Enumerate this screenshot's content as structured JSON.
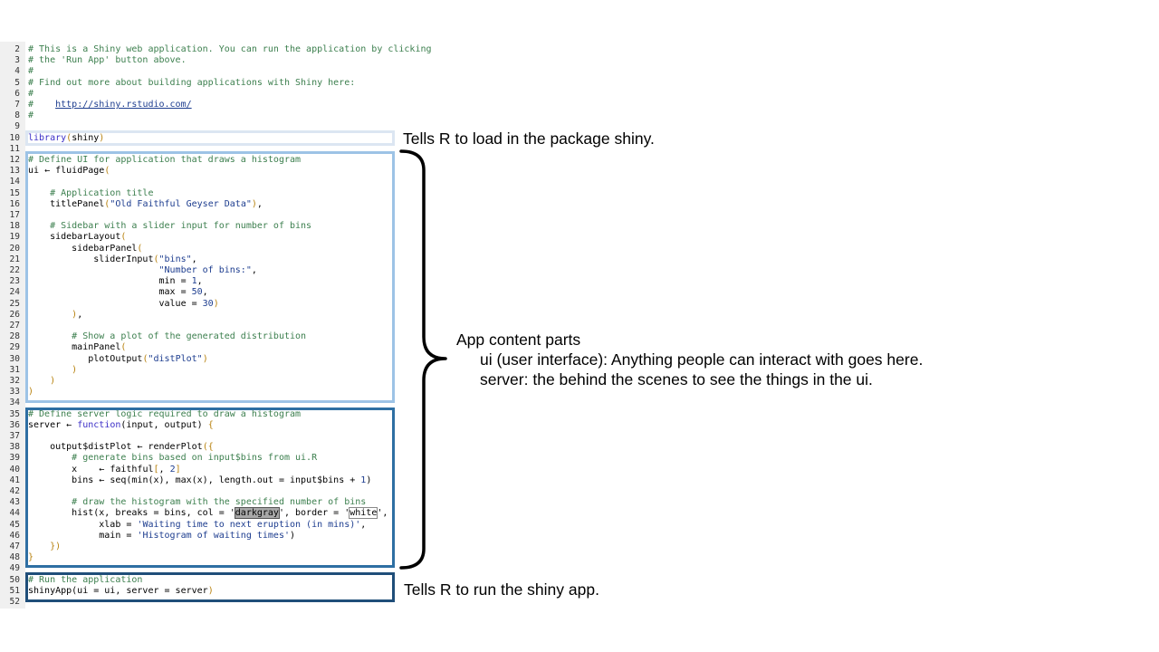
{
  "code_lines": [
    {
      "num": "2",
      "tokens": [
        {
          "t": "# This is a Shiny web application. You can run the application by clicking",
          "c": "comment"
        }
      ]
    },
    {
      "num": "3",
      "tokens": [
        {
          "t": "# the 'Run App' button above.",
          "c": "comment"
        }
      ]
    },
    {
      "num": "4",
      "tokens": [
        {
          "t": "#",
          "c": "comment"
        }
      ]
    },
    {
      "num": "5",
      "tokens": [
        {
          "t": "# Find out more about building applications with Shiny here:",
          "c": "comment"
        }
      ]
    },
    {
      "num": "6",
      "tokens": [
        {
          "t": "#",
          "c": "comment"
        }
      ]
    },
    {
      "num": "7",
      "tokens": [
        {
          "t": "#    ",
          "c": "comment"
        },
        {
          "t": "http://shiny.rstudio.com/",
          "c": "link"
        }
      ]
    },
    {
      "num": "8",
      "tokens": [
        {
          "t": "#",
          "c": "comment"
        }
      ]
    },
    {
      "num": "9",
      "tokens": []
    },
    {
      "num": "10",
      "tokens": [
        {
          "t": "library",
          "c": "keyword"
        },
        {
          "t": "(",
          "c": "paren"
        },
        {
          "t": "shiny",
          "c": "ident"
        },
        {
          "t": ")",
          "c": "paren"
        }
      ]
    },
    {
      "num": "11",
      "tokens": []
    },
    {
      "num": "12",
      "tokens": [
        {
          "t": "# Define UI for application that draws a histogram",
          "c": "comment"
        }
      ]
    },
    {
      "num": "13",
      "tokens": [
        {
          "t": "ui ",
          "c": "ident"
        },
        {
          "t": "←",
          "c": "ident"
        },
        {
          "t": " fluidPage",
          "c": "ident"
        },
        {
          "t": "(",
          "c": "paren"
        }
      ]
    },
    {
      "num": "14",
      "tokens": []
    },
    {
      "num": "15",
      "tokens": [
        {
          "t": "    # Application title",
          "c": "comment"
        }
      ]
    },
    {
      "num": "16",
      "tokens": [
        {
          "t": "    titlePanel",
          "c": "ident"
        },
        {
          "t": "(",
          "c": "paren"
        },
        {
          "t": "\"Old Faithful Geyser Data\"",
          "c": "string"
        },
        {
          "t": ")",
          "c": "paren"
        },
        {
          "t": ",",
          "c": "ident"
        }
      ]
    },
    {
      "num": "17",
      "tokens": []
    },
    {
      "num": "18",
      "tokens": [
        {
          "t": "    # Sidebar with a slider input for number of bins",
          "c": "comment"
        }
      ]
    },
    {
      "num": "19",
      "tokens": [
        {
          "t": "    sidebarLayout",
          "c": "ident"
        },
        {
          "t": "(",
          "c": "paren"
        }
      ]
    },
    {
      "num": "20",
      "tokens": [
        {
          "t": "        sidebarPanel",
          "c": "ident"
        },
        {
          "t": "(",
          "c": "paren"
        }
      ]
    },
    {
      "num": "21",
      "tokens": [
        {
          "t": "            sliderInput",
          "c": "ident"
        },
        {
          "t": "(",
          "c": "paren"
        },
        {
          "t": "\"bins\"",
          "c": "string"
        },
        {
          "t": ",",
          "c": "ident"
        }
      ]
    },
    {
      "num": "22",
      "tokens": [
        {
          "t": "                        \"Number of bins:\"",
          "c": "string"
        },
        {
          "t": ",",
          "c": "ident"
        }
      ]
    },
    {
      "num": "23",
      "tokens": [
        {
          "t": "                        min = ",
          "c": "ident"
        },
        {
          "t": "1",
          "c": "number"
        },
        {
          "t": ",",
          "c": "ident"
        }
      ]
    },
    {
      "num": "24",
      "tokens": [
        {
          "t": "                        max = ",
          "c": "ident"
        },
        {
          "t": "50",
          "c": "number"
        },
        {
          "t": ",",
          "c": "ident"
        }
      ]
    },
    {
      "num": "25",
      "tokens": [
        {
          "t": "                        value = ",
          "c": "ident"
        },
        {
          "t": "30",
          "c": "number"
        },
        {
          "t": ")",
          "c": "paren"
        }
      ]
    },
    {
      "num": "26",
      "tokens": [
        {
          "t": "        ",
          "c": "ident"
        },
        {
          "t": ")",
          "c": "paren"
        },
        {
          "t": ",",
          "c": "ident"
        }
      ]
    },
    {
      "num": "27",
      "tokens": []
    },
    {
      "num": "28",
      "tokens": [
        {
          "t": "        # Show a plot of the generated distribution",
          "c": "comment"
        }
      ]
    },
    {
      "num": "29",
      "tokens": [
        {
          "t": "        mainPanel",
          "c": "ident"
        },
        {
          "t": "(",
          "c": "paren"
        }
      ]
    },
    {
      "num": "30",
      "tokens": [
        {
          "t": "           plotOutput",
          "c": "ident"
        },
        {
          "t": "(",
          "c": "paren"
        },
        {
          "t": "\"distPlot\"",
          "c": "string"
        },
        {
          "t": ")",
          "c": "paren"
        }
      ]
    },
    {
      "num": "31",
      "tokens": [
        {
          "t": "        ",
          "c": "ident"
        },
        {
          "t": ")",
          "c": "paren"
        }
      ]
    },
    {
      "num": "32",
      "tokens": [
        {
          "t": "    ",
          "c": "ident"
        },
        {
          "t": ")",
          "c": "paren"
        }
      ]
    },
    {
      "num": "33",
      "tokens": [
        {
          "t": ")",
          "c": "paren"
        }
      ]
    },
    {
      "num": "34",
      "tokens": []
    },
    {
      "num": "35",
      "tokens": [
        {
          "t": "# Define server logic required to draw a histogram",
          "c": "comment"
        }
      ]
    },
    {
      "num": "36",
      "tokens": [
        {
          "t": "server ",
          "c": "ident"
        },
        {
          "t": "←",
          "c": "ident"
        },
        {
          "t": " ",
          "c": "ident"
        },
        {
          "t": "function",
          "c": "keyword"
        },
        {
          "t": "(input, output) ",
          "c": "ident"
        },
        {
          "t": "{",
          "c": "paren"
        }
      ]
    },
    {
      "num": "37",
      "tokens": []
    },
    {
      "num": "38",
      "tokens": [
        {
          "t": "    output$distPlot ",
          "c": "ident"
        },
        {
          "t": "←",
          "c": "ident"
        },
        {
          "t": " renderPlot",
          "c": "ident"
        },
        {
          "t": "({",
          "c": "paren"
        }
      ]
    },
    {
      "num": "39",
      "tokens": [
        {
          "t": "        # generate bins based on input$bins from ui.R",
          "c": "comment"
        }
      ]
    },
    {
      "num": "40",
      "tokens": [
        {
          "t": "        x    ",
          "c": "ident"
        },
        {
          "t": "←",
          "c": "ident"
        },
        {
          "t": " faithful",
          "c": "ident"
        },
        {
          "t": "[",
          "c": "paren"
        },
        {
          "t": ", ",
          "c": "ident"
        },
        {
          "t": "2",
          "c": "number"
        },
        {
          "t": "]",
          "c": "paren"
        }
      ]
    },
    {
      "num": "41",
      "tokens": [
        {
          "t": "        bins ",
          "c": "ident"
        },
        {
          "t": "←",
          "c": "ident"
        },
        {
          "t": " seq(min(x), max(x), length.out = input$bins + ",
          "c": "ident"
        },
        {
          "t": "1",
          "c": "number"
        },
        {
          "t": ")",
          "c": "ident"
        }
      ]
    },
    {
      "num": "42",
      "tokens": []
    },
    {
      "num": "43",
      "tokens": [
        {
          "t": "        # draw the histogram with the specified number of bins",
          "c": "comment"
        }
      ]
    },
    {
      "num": "44",
      "tokens": [
        {
          "t": "        hist(x, breaks = bins, col = '",
          "c": "ident"
        },
        {
          "t": "darkgray",
          "c": "hl-dark"
        },
        {
          "t": "', border = '",
          "c": "ident"
        },
        {
          "t": "white",
          "c": "hl-box"
        },
        {
          "t": "',",
          "c": "ident"
        }
      ]
    },
    {
      "num": "45",
      "tokens": [
        {
          "t": "             xlab = ",
          "c": "ident"
        },
        {
          "t": "'Waiting time to next eruption (in mins)'",
          "c": "string"
        },
        {
          "t": ",",
          "c": "ident"
        }
      ]
    },
    {
      "num": "46",
      "tokens": [
        {
          "t": "             main = ",
          "c": "ident"
        },
        {
          "t": "'Histogram of waiting times'",
          "c": "string"
        },
        {
          "t": ")",
          "c": "ident"
        }
      ]
    },
    {
      "num": "47",
      "tokens": [
        {
          "t": "    ",
          "c": "ident"
        },
        {
          "t": "})",
          "c": "paren"
        }
      ]
    },
    {
      "num": "48",
      "tokens": [
        {
          "t": "}",
          "c": "paren"
        }
      ]
    },
    {
      "num": "49",
      "tokens": []
    },
    {
      "num": "50",
      "tokens": [
        {
          "t": "# Run the application",
          "c": "comment"
        }
      ]
    },
    {
      "num": "51",
      "tokens": [
        {
          "t": "shinyApp(ui = ui, server = server",
          "c": "ident"
        },
        {
          "t": ")",
          "c": "paren"
        }
      ]
    },
    {
      "num": "52",
      "tokens": []
    }
  ],
  "annotations": {
    "library_note": "Tells R to load in the package shiny.",
    "app_parts_title": "App content parts",
    "ui_note": "ui (user interface): Anything people can interact with goes here.",
    "server_note": "server: the behind the scenes to see the things in the ui.",
    "run_note": "Tells R to run the shiny app."
  },
  "colors": {
    "library_box": "#dce6f2",
    "ui_box": "#9dc3e6",
    "server_box": "#2e6fa3",
    "run_box": "#1f4e79",
    "brace": "#000000"
  }
}
